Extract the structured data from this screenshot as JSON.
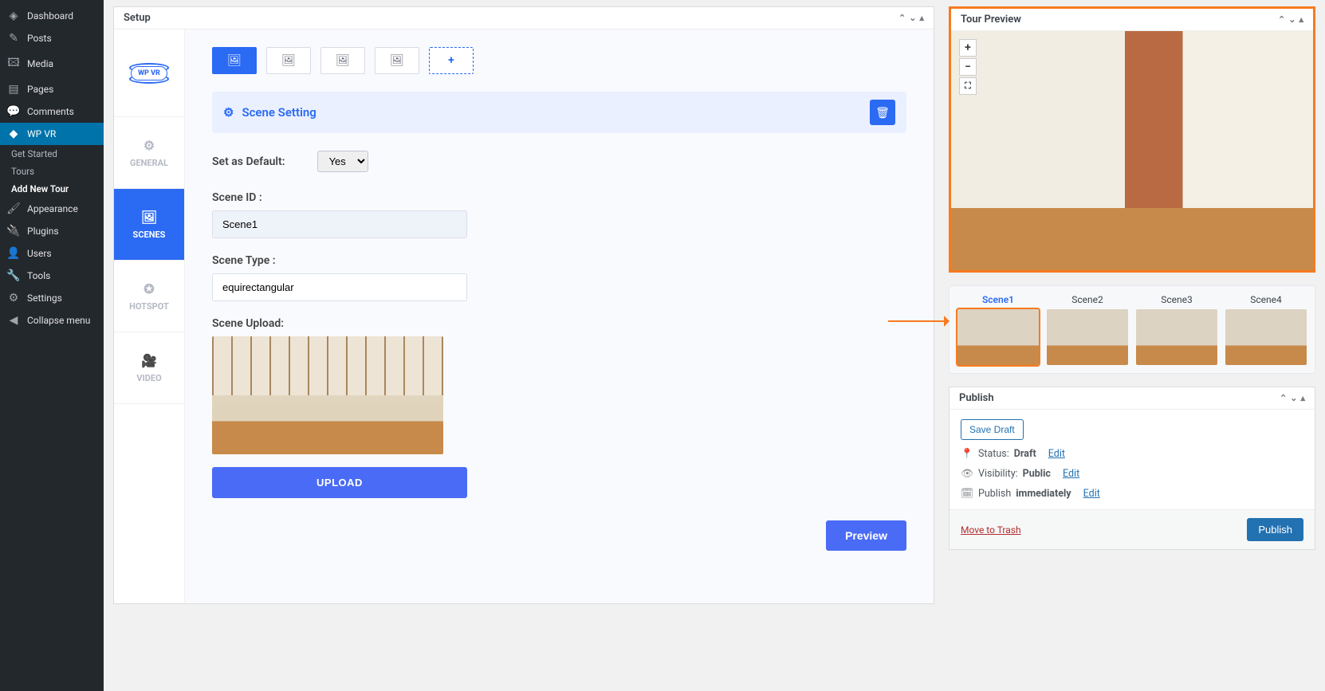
{
  "sidebar": {
    "items": [
      {
        "icon": "◈",
        "label": "Dashboard"
      },
      {
        "icon": "✎",
        "label": "Posts"
      },
      {
        "icon": "🖾",
        "label": "Media"
      },
      {
        "icon": "▤",
        "label": "Pages"
      },
      {
        "icon": "💬",
        "label": "Comments"
      },
      {
        "icon": "◆",
        "label": "WP VR"
      },
      {
        "icon": "🖌",
        "label": "Appearance"
      },
      {
        "icon": "🔌",
        "label": "Plugins"
      },
      {
        "icon": "👤",
        "label": "Users"
      },
      {
        "icon": "🔧",
        "label": "Tools"
      },
      {
        "icon": "⚙",
        "label": "Settings"
      },
      {
        "icon": "◀",
        "label": "Collapse menu"
      }
    ],
    "sub": [
      "Get Started",
      "Tours",
      "Add New Tour"
    ]
  },
  "setup": {
    "title": "Setup",
    "tabs": {
      "general": "GENERAL",
      "scenes": "SCENES",
      "hotspot": "HOTSPOT",
      "video": "VIDEO"
    },
    "scene_setting": "Scene Setting",
    "set_default_label": "Set as Default:",
    "set_default_value": "Yes",
    "scene_id_label": "Scene ID :",
    "scene_id_value": "Scene1",
    "scene_type_label": "Scene Type :",
    "scene_type_value": "equirectangular",
    "scene_upload_label": "Scene Upload:",
    "upload_btn": "UPLOAD",
    "preview_btn": "Preview"
  },
  "tour": {
    "title": "Tour Preview",
    "scenes": [
      "Scene1",
      "Scene2",
      "Scene3",
      "Scene4"
    ]
  },
  "publish": {
    "title": "Publish",
    "save_draft": "Save Draft",
    "status_label": "Status: ",
    "status_value": "Draft",
    "visibility_label": "Visibility: ",
    "visibility_value": "Public",
    "time_label": "Publish ",
    "time_value": "immediately",
    "edit": "Edit",
    "trash": "Move to Trash",
    "publish_btn": "Publish"
  }
}
